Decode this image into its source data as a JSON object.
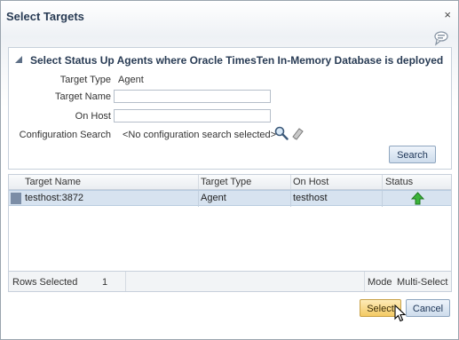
{
  "dialog": {
    "title": "Select Targets",
    "close_label": "×"
  },
  "search": {
    "panel_title": "Select Status Up Agents where Oracle TimesTen In-Memory Database is deployed",
    "target_type_label": "Target Type",
    "target_type_value": "Agent",
    "target_name_label": "Target Name",
    "target_name_value": "",
    "on_host_label": "On Host",
    "on_host_value": "",
    "config_search_label": "Configuration Search",
    "config_search_value": "<No configuration search selected>",
    "search_button": "Search"
  },
  "table": {
    "columns": [
      "Target Name",
      "Target Type",
      "On Host",
      "Status"
    ],
    "rows": [
      {
        "target_name": "testhost:3872",
        "target_type": "Agent",
        "on_host": "testhost",
        "status": "up"
      }
    ],
    "rows_selected_label": "Rows Selected",
    "rows_selected_count": "1",
    "mode_label": "Mode",
    "mode_value": "Multi-Select"
  },
  "footer": {
    "select_button": "Select",
    "cancel_button": "Cancel"
  },
  "colors": {
    "accent": "#283b54",
    "selected_row": "#d7e3f0",
    "status_up": "#3bb33b",
    "select_button_bg": "#f9d98a"
  },
  "icons": [
    "close-icon",
    "help-icon",
    "disclosure-triangle-icon",
    "search-magnifier-icon",
    "clear-eraser-icon",
    "status-up-arrow-icon",
    "mouse-cursor-icon"
  ]
}
